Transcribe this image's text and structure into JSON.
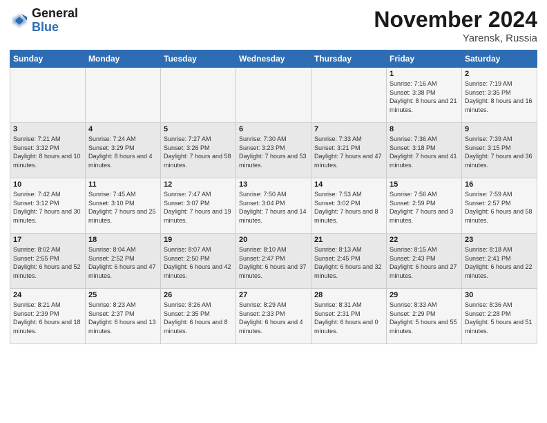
{
  "logo": {
    "text_general": "General",
    "text_blue": "Blue"
  },
  "header": {
    "month": "November 2024",
    "location": "Yarensk, Russia"
  },
  "weekdays": [
    "Sunday",
    "Monday",
    "Tuesday",
    "Wednesday",
    "Thursday",
    "Friday",
    "Saturday"
  ],
  "weeks": [
    [
      {
        "day": "",
        "info": ""
      },
      {
        "day": "",
        "info": ""
      },
      {
        "day": "",
        "info": ""
      },
      {
        "day": "",
        "info": ""
      },
      {
        "day": "",
        "info": ""
      },
      {
        "day": "1",
        "info": "Sunrise: 7:16 AM\nSunset: 3:38 PM\nDaylight: 8 hours and 21 minutes."
      },
      {
        "day": "2",
        "info": "Sunrise: 7:19 AM\nSunset: 3:35 PM\nDaylight: 8 hours and 16 minutes."
      }
    ],
    [
      {
        "day": "3",
        "info": "Sunrise: 7:21 AM\nSunset: 3:32 PM\nDaylight: 8 hours and 10 minutes."
      },
      {
        "day": "4",
        "info": "Sunrise: 7:24 AM\nSunset: 3:29 PM\nDaylight: 8 hours and 4 minutes."
      },
      {
        "day": "5",
        "info": "Sunrise: 7:27 AM\nSunset: 3:26 PM\nDaylight: 7 hours and 58 minutes."
      },
      {
        "day": "6",
        "info": "Sunrise: 7:30 AM\nSunset: 3:23 PM\nDaylight: 7 hours and 53 minutes."
      },
      {
        "day": "7",
        "info": "Sunrise: 7:33 AM\nSunset: 3:21 PM\nDaylight: 7 hours and 47 minutes."
      },
      {
        "day": "8",
        "info": "Sunrise: 7:36 AM\nSunset: 3:18 PM\nDaylight: 7 hours and 41 minutes."
      },
      {
        "day": "9",
        "info": "Sunrise: 7:39 AM\nSunset: 3:15 PM\nDaylight: 7 hours and 36 minutes."
      }
    ],
    [
      {
        "day": "10",
        "info": "Sunrise: 7:42 AM\nSunset: 3:12 PM\nDaylight: 7 hours and 30 minutes."
      },
      {
        "day": "11",
        "info": "Sunrise: 7:45 AM\nSunset: 3:10 PM\nDaylight: 7 hours and 25 minutes."
      },
      {
        "day": "12",
        "info": "Sunrise: 7:47 AM\nSunset: 3:07 PM\nDaylight: 7 hours and 19 minutes."
      },
      {
        "day": "13",
        "info": "Sunrise: 7:50 AM\nSunset: 3:04 PM\nDaylight: 7 hours and 14 minutes."
      },
      {
        "day": "14",
        "info": "Sunrise: 7:53 AM\nSunset: 3:02 PM\nDaylight: 7 hours and 8 minutes."
      },
      {
        "day": "15",
        "info": "Sunrise: 7:56 AM\nSunset: 2:59 PM\nDaylight: 7 hours and 3 minutes."
      },
      {
        "day": "16",
        "info": "Sunrise: 7:59 AM\nSunset: 2:57 PM\nDaylight: 6 hours and 58 minutes."
      }
    ],
    [
      {
        "day": "17",
        "info": "Sunrise: 8:02 AM\nSunset: 2:55 PM\nDaylight: 6 hours and 52 minutes."
      },
      {
        "day": "18",
        "info": "Sunrise: 8:04 AM\nSunset: 2:52 PM\nDaylight: 6 hours and 47 minutes."
      },
      {
        "day": "19",
        "info": "Sunrise: 8:07 AM\nSunset: 2:50 PM\nDaylight: 6 hours and 42 minutes."
      },
      {
        "day": "20",
        "info": "Sunrise: 8:10 AM\nSunset: 2:47 PM\nDaylight: 6 hours and 37 minutes."
      },
      {
        "day": "21",
        "info": "Sunrise: 8:13 AM\nSunset: 2:45 PM\nDaylight: 6 hours and 32 minutes."
      },
      {
        "day": "22",
        "info": "Sunrise: 8:15 AM\nSunset: 2:43 PM\nDaylight: 6 hours and 27 minutes."
      },
      {
        "day": "23",
        "info": "Sunrise: 8:18 AM\nSunset: 2:41 PM\nDaylight: 6 hours and 22 minutes."
      }
    ],
    [
      {
        "day": "24",
        "info": "Sunrise: 8:21 AM\nSunset: 2:39 PM\nDaylight: 6 hours and 18 minutes."
      },
      {
        "day": "25",
        "info": "Sunrise: 8:23 AM\nSunset: 2:37 PM\nDaylight: 6 hours and 13 minutes."
      },
      {
        "day": "26",
        "info": "Sunrise: 8:26 AM\nSunset: 2:35 PM\nDaylight: 6 hours and 8 minutes."
      },
      {
        "day": "27",
        "info": "Sunrise: 8:29 AM\nSunset: 2:33 PM\nDaylight: 6 hours and 4 minutes."
      },
      {
        "day": "28",
        "info": "Sunrise: 8:31 AM\nSunset: 2:31 PM\nDaylight: 6 hours and 0 minutes."
      },
      {
        "day": "29",
        "info": "Sunrise: 8:33 AM\nSunset: 2:29 PM\nDaylight: 5 hours and 55 minutes."
      },
      {
        "day": "30",
        "info": "Sunrise: 8:36 AM\nSunset: 2:28 PM\nDaylight: 5 hours and 51 minutes."
      }
    ]
  ]
}
